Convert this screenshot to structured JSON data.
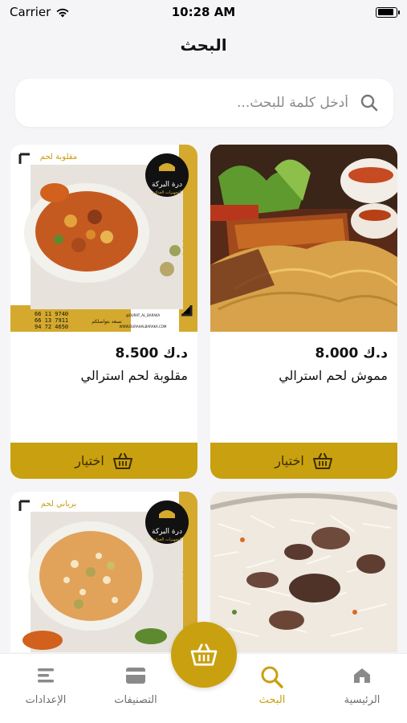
{
  "status_bar": {
    "carrier": "Carrier",
    "time": "10:28 AM",
    "battery_level": 0.9
  },
  "header": {
    "title": "البحث"
  },
  "search": {
    "placeholder": "أدخل كلمة للبحث..."
  },
  "products": [
    {
      "name": "مموش لحم استرالي",
      "price": "د.ك 8.000",
      "button": "اختيار"
    },
    {
      "name": "مقلوبة لحم استرالي",
      "price": "د.ك 8.500",
      "button": "اختيار",
      "poster": {
        "tag": "مقلوبة لحم",
        "brand_title": "درة البركة",
        "brand_subtitle": "للتجهيزات الغذائية",
        "tagline": "نسعد بتواصلكم",
        "handle": "@DURAT_AL_BARAKA",
        "site": "WWW.DURAHALBARAKA.COM",
        "phones": [
          "66 11 9740",
          "66 13 7911",
          "94 72 4650"
        ]
      }
    },
    {
      "name": "",
      "price": "",
      "button": ""
    },
    {
      "name": "",
      "price": "",
      "button": "",
      "poster": {
        "tag": "برياني لحم",
        "brand_title": "درة البركة",
        "brand_subtitle": "للتجهيزات الغذائية"
      }
    }
  ],
  "bottom_nav": {
    "items": [
      {
        "label": "الرئيسية",
        "icon": "home-icon",
        "active": false
      },
      {
        "label": "البحث",
        "icon": "search-icon",
        "active": true
      },
      {
        "label": "التصنيفات",
        "icon": "categories-icon",
        "active": false
      },
      {
        "label": "الإعدادات",
        "icon": "settings-icon",
        "active": false
      }
    ],
    "cart_icon": "basket-icon"
  },
  "colors": {
    "accent": "#c9a00f",
    "background": "#f5f5f7",
    "inactive": "#6d6d6d"
  }
}
